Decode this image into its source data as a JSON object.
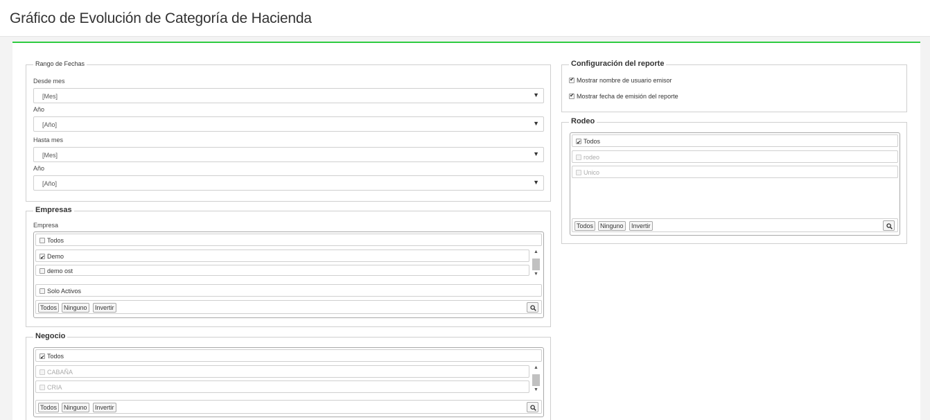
{
  "page": {
    "title": "Gráfico de Evolución de Categoría de Hacienda"
  },
  "accent_color": "#2ecc40",
  "rango_fechas": {
    "legend": "Rango de Fechas",
    "desde_mes": {
      "label": "Desde mes",
      "value": "[Mes]"
    },
    "desde_anio": {
      "label": "Año",
      "value": "[Año]"
    },
    "hasta_mes": {
      "label": "Hasta mes",
      "value": "[Mes]"
    },
    "hasta_anio": {
      "label": "Año",
      "value": "[Año]"
    },
    "arrow": "▼"
  },
  "empresas": {
    "legend": "Empresas",
    "label": "Empresa",
    "todos": {
      "label": "Todos",
      "checked": false
    },
    "items": [
      {
        "label": "Demo",
        "checked": true
      },
      {
        "label": "demo ost",
        "checked": false
      }
    ],
    "solo_activos": {
      "label": "Solo Activos",
      "checked": false
    },
    "buttons": {
      "todos": "Todos",
      "ninguno": "Ninguno",
      "invertir": "Invertir"
    }
  },
  "negocio": {
    "legend": "Negocio",
    "todos": {
      "label": "Todos",
      "checked": true
    },
    "items": [
      {
        "label": "CABAÑA",
        "checked": false,
        "disabled": true
      },
      {
        "label": "CRIA",
        "checked": false,
        "disabled": true
      }
    ],
    "buttons": {
      "todos": "Todos",
      "ninguno": "Ninguno",
      "invertir": "Invertir"
    }
  },
  "configuracion": {
    "legend": "Configuración del reporte",
    "options": [
      {
        "label": "Mostrar nombre de usuario emisor",
        "checked": true
      },
      {
        "label": "Mostrar fecha de emisión del reporte",
        "checked": true
      }
    ]
  },
  "rodeo": {
    "legend": "Rodeo",
    "todos": {
      "label": "Todos",
      "checked": true
    },
    "items": [
      {
        "label": "rodeo",
        "checked": false,
        "disabled": true
      },
      {
        "label": "Unico",
        "checked": false,
        "disabled": true
      }
    ],
    "buttons": {
      "todos": "Todos",
      "ninguno": "Ninguno",
      "invertir": "Invertir"
    }
  }
}
